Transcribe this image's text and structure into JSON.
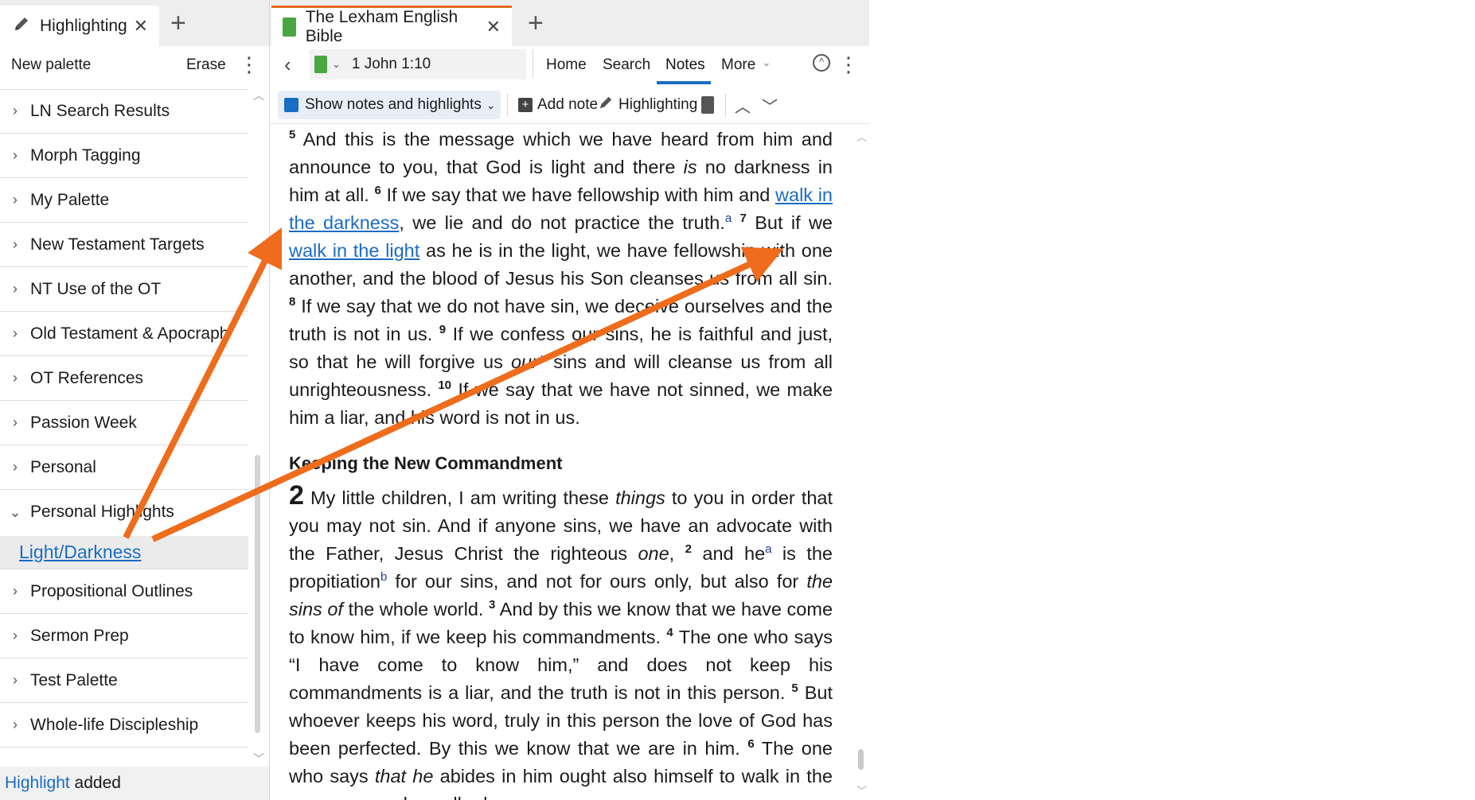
{
  "left": {
    "tab_label": "Highlighting",
    "palette_label": "New palette",
    "erase_label": "Erase",
    "items": [
      {
        "label": "LN Search Results"
      },
      {
        "label": "Morph Tagging"
      },
      {
        "label": "My Palette"
      },
      {
        "label": "New Testament Targets"
      },
      {
        "label": "NT Use of the OT"
      },
      {
        "label": "Old Testament & Apocraph"
      },
      {
        "label": "OT References"
      },
      {
        "label": "Passion Week"
      },
      {
        "label": "Personal"
      },
      {
        "label": "Personal Highlights"
      },
      {
        "label": "Propositional Outlines"
      },
      {
        "label": "Sermon Prep"
      },
      {
        "label": "Test Palette"
      },
      {
        "label": "Whole-life Discipleship"
      }
    ],
    "sub_item": "Light/Darkness",
    "status_highlight": "Highlight",
    "status_rest": " added"
  },
  "right": {
    "tab_label": "The Lexham English Bible",
    "reference": "1 John 1:10",
    "nav": {
      "home": "Home",
      "search": "Search",
      "notes": "Notes",
      "more": "More"
    },
    "toolbar": {
      "show": "Show notes and highlights",
      "add_note": "Add note",
      "highlighting": "Highlighting"
    },
    "text": {
      "v5_num": "5",
      "v5": "And this is the message which we have heard from him and announce to you, that God is light and there ",
      "v5_is": "is",
      "v5_end": " no darkness in him at all.",
      "v6_num": "6",
      "v6_a": "If we say that we have fellowship with him and ",
      "v6_link": "walk in the darkness",
      "v6_b": ", we lie and do not practice the truth.",
      "fn_a": "a",
      "v7_num": "7",
      "v7_a": "But if we ",
      "v7_link": "walk in the light",
      "v7_b": " as he is in the light, we have fellowship with one another, and the blood of Jesus his Son cleanses us from all sin.",
      "v8_num": "8",
      "v8": "If we say that we do not have sin, we deceive ourselves and the truth is not in us.",
      "v9_num": "9",
      "v9_a": "If we confess our sins, he is faithful and just, so that he will forgive us ",
      "v9_our": "our",
      "v9_star": "*",
      "v9_b": " sins and will cleanse us from all unrighteousness.",
      "v10_num": "10",
      "v10": "If we say that we have not sinned, we make him a liar, and his word is not in us.",
      "heading": "Keeping the New Commandment",
      "ch2": "2",
      "c2v1_a": "My little children, I am writing these ",
      "c2v1_things": "things",
      "c2v1_b": " to you in order that you may not sin. And if anyone sins, we have an advocate with the Father, Jesus Christ the righteous ",
      "c2v1_one": "one",
      "c2v1_c": ",",
      "c2v2_num": "2",
      "c2v2_a": "and he",
      "fn2_a": "a",
      "c2v2_b": " is the propitiation",
      "fn2_b": "b",
      "c2v2_c": " for our sins, and not for ours only, but also for ",
      "c2v2_italic": "the sins of",
      "c2v2_d": " the whole world.",
      "c2v3_num": "3",
      "c2v3": "And by this we know that we have come to know him, if we keep his commandments.",
      "c2v4_num": "4",
      "c2v4": "The one who says “I have come to know him,” and does not keep his commandments is a liar, and the truth is not in this person.",
      "c2v5_num": "5",
      "c2v5": "But whoever keeps his word, truly in this person the love of God has been perfected. By this we know that we are in him.",
      "c2v6_num": "6",
      "c2v6_a": "The one who says ",
      "c2v6_italic": "that he",
      "c2v6_b": " abides in him ought also himself to walk in the same way as he walked."
    }
  },
  "colors": {
    "accent": "#1a6cc4",
    "arrow": "#ee6c1c"
  }
}
